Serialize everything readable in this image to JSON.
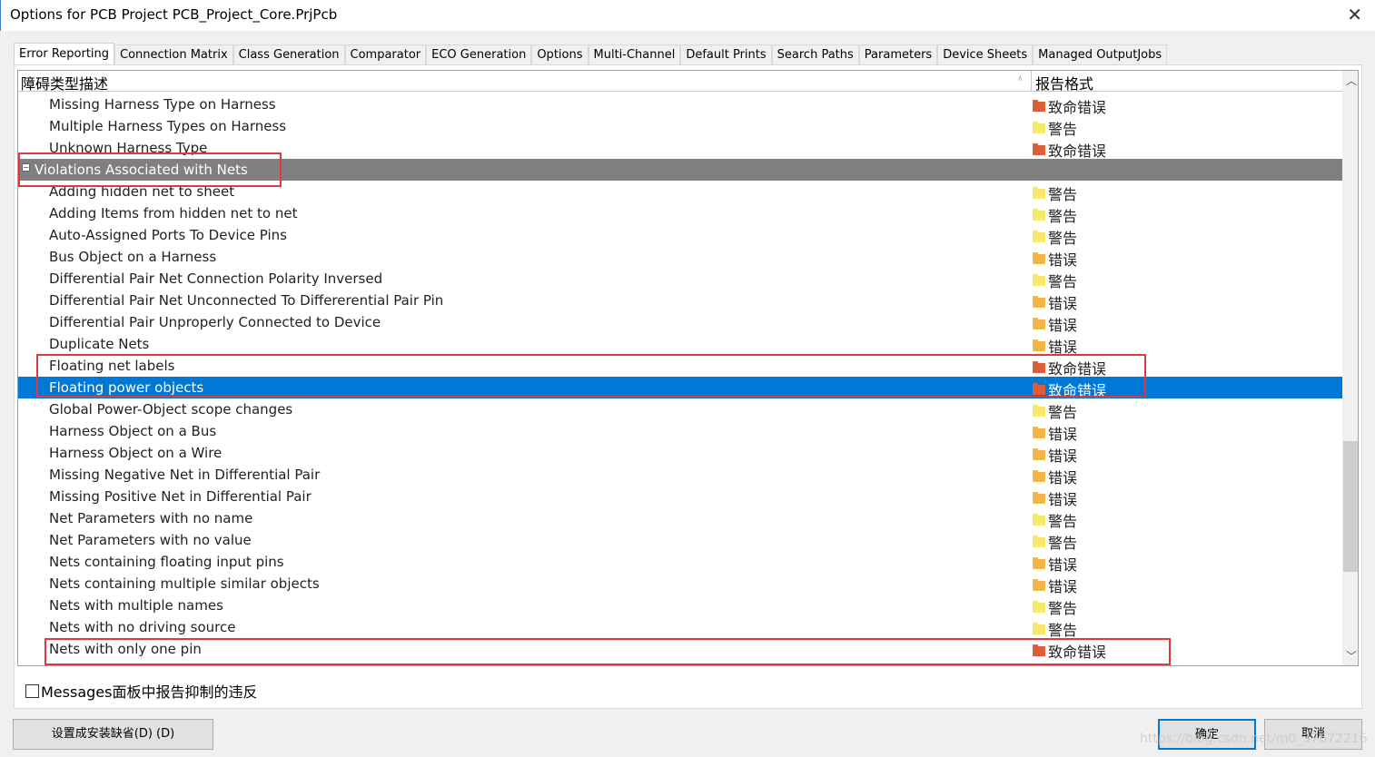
{
  "window": {
    "title": "Options for PCB Project PCB_Project_Core.PrjPcb",
    "close": "✕"
  },
  "tabs": [
    "Error Reporting",
    "Connection Matrix",
    "Class Generation",
    "Comparator",
    "ECO Generation",
    "Options",
    "Multi-Channel",
    "Default Prints",
    "Search Paths",
    "Parameters",
    "Device Sheets",
    "Managed OutputJobs"
  ],
  "active_tab": "Error Reporting",
  "table": {
    "col1": "障碍类型描述",
    "col2": "报告格式",
    "rows": [
      {
        "name": "Missing Harness Type on Harness",
        "level": "致命错误",
        "type": "fatal"
      },
      {
        "name": "Multiple Harness Types on Harness",
        "level": "警告",
        "type": "warning"
      },
      {
        "name": "Unknown Harness Type",
        "level": "致命错误",
        "type": "fatal"
      },
      {
        "name": "Violations Associated with Nets",
        "group": true
      },
      {
        "name": "Adding hidden net to sheet",
        "level": "警告",
        "type": "warning"
      },
      {
        "name": "Adding Items from hidden net to net",
        "level": "警告",
        "type": "warning"
      },
      {
        "name": "Auto-Assigned Ports To Device Pins",
        "level": "警告",
        "type": "warning"
      },
      {
        "name": "Bus Object on a Harness",
        "level": "错误",
        "type": "error"
      },
      {
        "name": "Differential Pair Net Connection Polarity Inversed",
        "level": "警告",
        "type": "warning"
      },
      {
        "name": "Differential Pair Net Unconnected To Differerential Pair Pin",
        "level": "错误",
        "type": "error"
      },
      {
        "name": "Differential Pair Unproperly Connected to Device",
        "level": "错误",
        "type": "error"
      },
      {
        "name": "Duplicate Nets",
        "level": "错误",
        "type": "error"
      },
      {
        "name": "Floating net labels",
        "level": "致命错误",
        "type": "fatal"
      },
      {
        "name": "Floating power objects",
        "level": "致命错误",
        "type": "fatal",
        "selected": true
      },
      {
        "name": "Global Power-Object scope changes",
        "level": "警告",
        "type": "warning"
      },
      {
        "name": "Harness Object on a Bus",
        "level": "错误",
        "type": "error"
      },
      {
        "name": "Harness Object on a Wire",
        "level": "错误",
        "type": "error"
      },
      {
        "name": "Missing Negative Net in Differential Pair",
        "level": "错误",
        "type": "error"
      },
      {
        "name": "Missing Positive Net in Differential Pair",
        "level": "错误",
        "type": "error"
      },
      {
        "name": "Net Parameters with no name",
        "level": "警告",
        "type": "warning"
      },
      {
        "name": "Net Parameters with no value",
        "level": "警告",
        "type": "warning"
      },
      {
        "name": "Nets containing floating input pins",
        "level": "错误",
        "type": "error"
      },
      {
        "name": "Nets containing multiple similar objects",
        "level": "错误",
        "type": "error"
      },
      {
        "name": "Nets with multiple names",
        "level": "警告",
        "type": "warning"
      },
      {
        "name": "Nets with no driving source",
        "level": "警告",
        "type": "warning"
      },
      {
        "name": "Nets with only one pin",
        "level": "致命错误",
        "type": "fatal"
      }
    ]
  },
  "colors": {
    "fatal": "#d9603b",
    "error": "#f0b648",
    "warning": "#f7e76a",
    "group_bg": "#808080",
    "selected_bg": "#0078d7",
    "highlight_box": "#e0393b"
  },
  "checkbox": {
    "label": "Messages面板中报告抑制的违反",
    "checked": false
  },
  "buttons": {
    "defaults": "设置成安装缺省(D) (D)",
    "ok": "确定",
    "cancel": "取消"
  },
  "watermark": "https://blog.csdn.net/m0_37672216"
}
